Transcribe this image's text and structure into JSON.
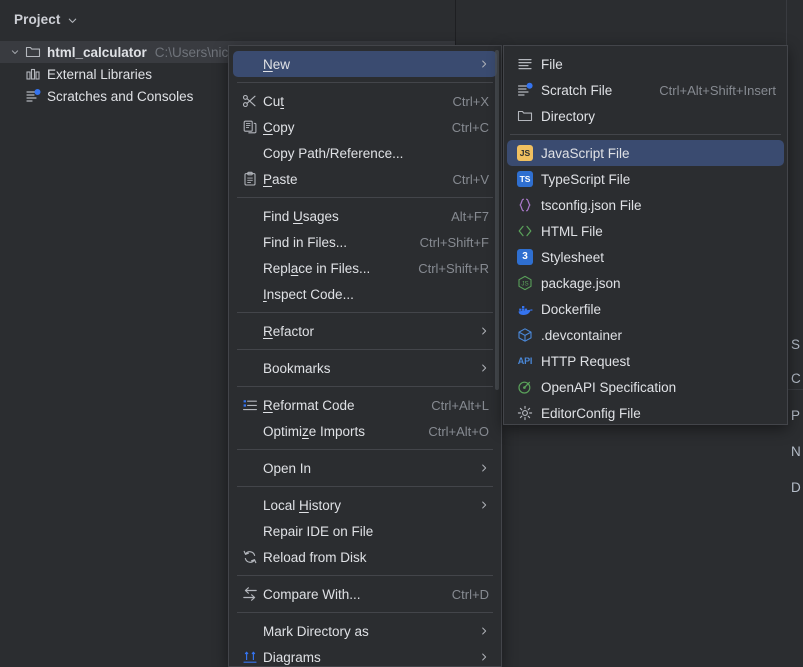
{
  "app": {
    "theme_background": "#2b2d30",
    "accent_highlight": "#3a4b70",
    "text_color": "#dfe1e5",
    "muted_text_color": "#868a91"
  },
  "project_panel": {
    "title": "Project",
    "chevron_icon": "chevron-down-icon",
    "tree": [
      {
        "label": "html_calculator",
        "path": "C:\\Users\\nic",
        "icon": "folder-icon",
        "arrow": "chevron-down-icon",
        "selected": true,
        "depth": 0
      },
      {
        "label": "External Libraries",
        "path": "",
        "icon": "library-icon",
        "arrow": "",
        "selected": false,
        "depth": 1
      },
      {
        "label": "Scratches and Consoles",
        "path": "",
        "icon": "scratches-icon",
        "arrow": "",
        "selected": false,
        "depth": 1
      }
    ]
  },
  "background_panel": {
    "partial_labels": [
      "S",
      "C",
      "P",
      "N",
      "D"
    ]
  },
  "context_menu": {
    "items": [
      {
        "type": "item",
        "label": "New",
        "mnemonic": "N",
        "shortcut": "",
        "icon": "",
        "submenu_arrow": true,
        "highlight": true
      },
      {
        "type": "separator"
      },
      {
        "type": "item",
        "label": "Cut",
        "mnemonic": "t",
        "shortcut": "Ctrl+X",
        "icon": "scissors-icon",
        "submenu_arrow": false,
        "highlight": false
      },
      {
        "type": "item",
        "label": "Copy",
        "mnemonic": "C",
        "shortcut": "Ctrl+C",
        "icon": "copy-icon",
        "submenu_arrow": false,
        "highlight": false
      },
      {
        "type": "item",
        "label": "Copy Path/Reference...",
        "mnemonic": "",
        "shortcut": "",
        "icon": "",
        "submenu_arrow": false,
        "highlight": false
      },
      {
        "type": "item",
        "label": "Paste",
        "mnemonic": "P",
        "shortcut": "Ctrl+V",
        "icon": "clipboard-icon",
        "submenu_arrow": false,
        "highlight": false
      },
      {
        "type": "separator"
      },
      {
        "type": "item",
        "label": "Find Usages",
        "mnemonic": "U",
        "shortcut": "Alt+F7",
        "icon": "",
        "submenu_arrow": false,
        "highlight": false
      },
      {
        "type": "item",
        "label": "Find in Files...",
        "mnemonic": "",
        "shortcut": "Ctrl+Shift+F",
        "icon": "",
        "submenu_arrow": false,
        "highlight": false
      },
      {
        "type": "item",
        "label": "Replace in Files...",
        "mnemonic": "a",
        "shortcut": "Ctrl+Shift+R",
        "icon": "",
        "submenu_arrow": false,
        "highlight": false
      },
      {
        "type": "item",
        "label": "Inspect Code...",
        "mnemonic": "I",
        "shortcut": "",
        "icon": "",
        "submenu_arrow": false,
        "highlight": false
      },
      {
        "type": "separator"
      },
      {
        "type": "item",
        "label": "Refactor",
        "mnemonic": "R",
        "shortcut": "",
        "icon": "",
        "submenu_arrow": true,
        "highlight": false
      },
      {
        "type": "separator"
      },
      {
        "type": "item",
        "label": "Bookmarks",
        "mnemonic": "",
        "shortcut": "",
        "icon": "",
        "submenu_arrow": true,
        "highlight": false
      },
      {
        "type": "separator"
      },
      {
        "type": "item",
        "label": "Reformat Code",
        "mnemonic": "R",
        "shortcut": "Ctrl+Alt+L",
        "icon": "reformat-icon",
        "submenu_arrow": false,
        "highlight": false
      },
      {
        "type": "item",
        "label": "Optimize Imports",
        "mnemonic": "z",
        "shortcut": "Ctrl+Alt+O",
        "icon": "",
        "submenu_arrow": false,
        "highlight": false
      },
      {
        "type": "separator"
      },
      {
        "type": "item",
        "label": "Open In",
        "mnemonic": "",
        "shortcut": "",
        "icon": "",
        "submenu_arrow": true,
        "highlight": false
      },
      {
        "type": "separator"
      },
      {
        "type": "item",
        "label": "Local History",
        "mnemonic": "H",
        "shortcut": "",
        "icon": "",
        "submenu_arrow": true,
        "highlight": false
      },
      {
        "type": "item",
        "label": "Repair IDE on File",
        "mnemonic": "",
        "shortcut": "",
        "icon": "",
        "submenu_arrow": false,
        "highlight": false
      },
      {
        "type": "item",
        "label": "Reload from Disk",
        "mnemonic": "",
        "shortcut": "",
        "icon": "reload-icon",
        "submenu_arrow": false,
        "highlight": false
      },
      {
        "type": "separator"
      },
      {
        "type": "item",
        "label": "Compare With...",
        "mnemonic": "",
        "shortcut": "Ctrl+D",
        "icon": "compare-icon",
        "submenu_arrow": false,
        "highlight": false
      },
      {
        "type": "separator"
      },
      {
        "type": "item",
        "label": "Mark Directory as",
        "mnemonic": "",
        "shortcut": "",
        "icon": "",
        "submenu_arrow": true,
        "highlight": false
      },
      {
        "type": "item",
        "label": "Diagrams",
        "mnemonic": "",
        "shortcut": "",
        "icon": "diagrams-icon",
        "submenu_arrow": true,
        "highlight": false
      }
    ]
  },
  "new_submenu": {
    "items": [
      {
        "type": "item",
        "label": "File",
        "shortcut": "",
        "icon": "file-lines-icon",
        "highlight": false
      },
      {
        "type": "item",
        "label": "Scratch File",
        "shortcut": "Ctrl+Alt+Shift+Insert",
        "icon": "scratch-file-icon",
        "highlight": false
      },
      {
        "type": "item",
        "label": "Directory",
        "shortcut": "",
        "icon": "folder-icon",
        "highlight": false
      },
      {
        "type": "separator"
      },
      {
        "type": "item",
        "label": "JavaScript File",
        "shortcut": "",
        "icon": "js-file-icon",
        "highlight": true
      },
      {
        "type": "item",
        "label": "TypeScript File",
        "shortcut": "",
        "icon": "ts-file-icon",
        "highlight": false
      },
      {
        "type": "item",
        "label": "tsconfig.json File",
        "shortcut": "",
        "icon": "tsconfig-icon",
        "highlight": false
      },
      {
        "type": "item",
        "label": "HTML File",
        "shortcut": "",
        "icon": "html-file-icon",
        "highlight": false
      },
      {
        "type": "item",
        "label": "Stylesheet",
        "shortcut": "",
        "icon": "css-file-icon",
        "highlight": false
      },
      {
        "type": "item",
        "label": "package.json",
        "shortcut": "",
        "icon": "npm-package-icon",
        "highlight": false
      },
      {
        "type": "item",
        "label": "Dockerfile",
        "shortcut": "",
        "icon": "docker-icon",
        "highlight": false
      },
      {
        "type": "item",
        "label": ".devcontainer",
        "shortcut": "",
        "icon": "devcontainer-cube-icon",
        "highlight": false
      },
      {
        "type": "item",
        "label": "HTTP Request",
        "shortcut": "",
        "icon": "api-icon",
        "highlight": false
      },
      {
        "type": "item",
        "label": "OpenAPI Specification",
        "shortcut": "",
        "icon": "openapi-icon",
        "highlight": false
      },
      {
        "type": "item",
        "label": "EditorConfig File",
        "shortcut": "",
        "icon": "gear-icon",
        "highlight": false
      }
    ]
  }
}
